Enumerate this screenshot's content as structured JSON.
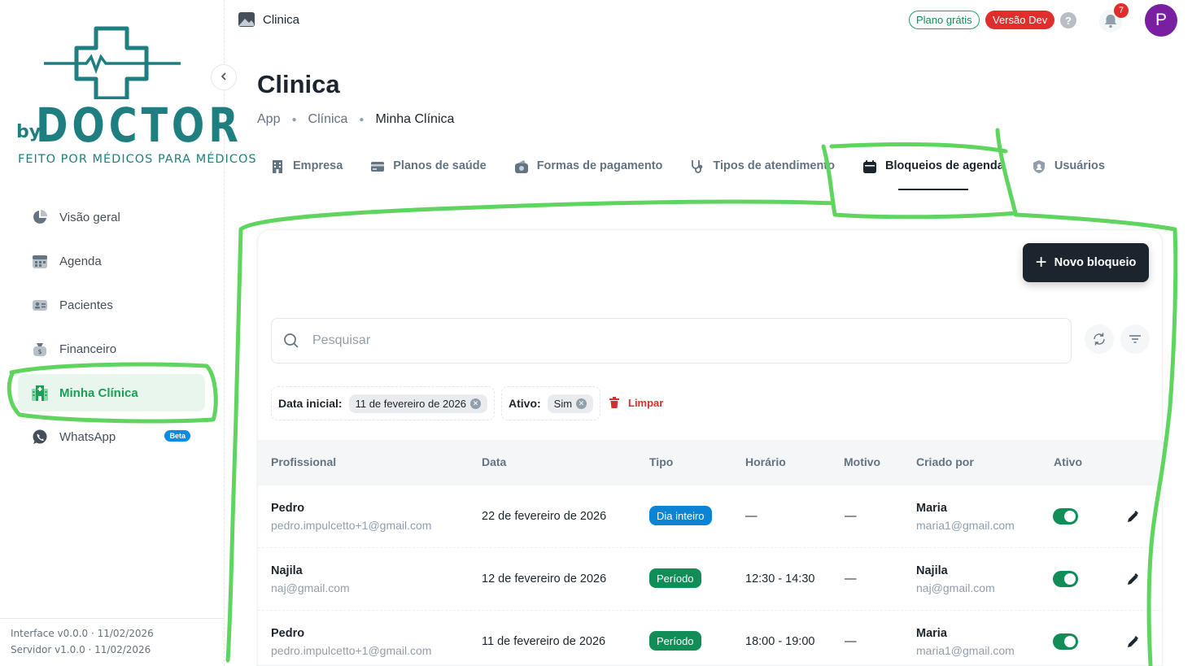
{
  "app": {
    "logo_by": "by",
    "logo_name": "DOCTOR",
    "logo_tagline": "FEITO POR MÉDICOS PARA MÉDICOS",
    "top_title": "Clinica",
    "plan_badge": "Plano grátis",
    "dev_badge": "Versão Dev",
    "help": "?",
    "notifications": "7",
    "avatar_letter": "P",
    "colors": {
      "brand": "#1f7f80",
      "accent": "#1a9f53",
      "dark": "#1c252e",
      "danger": "#e02d2d",
      "annotation": "#5fd45f"
    }
  },
  "sidebar": {
    "items": [
      {
        "label": "Visão geral",
        "icon": "pie-chart-icon"
      },
      {
        "label": "Agenda",
        "icon": "calendar-icon"
      },
      {
        "label": "Pacientes",
        "icon": "id-card-icon"
      },
      {
        "label": "Financeiro",
        "icon": "money-bag-icon"
      },
      {
        "label": "Minha Clínica",
        "icon": "hospital-icon",
        "active": true
      },
      {
        "label": "WhatsApp",
        "icon": "whatsapp-icon",
        "badge": "Beta"
      }
    ],
    "footer_interface": "Interface v0.0.0 · 11/02/2026",
    "footer_server": "Servidor v1.0.0 · 11/02/2026"
  },
  "page": {
    "title": "Clinica",
    "breadcrumb": [
      "App",
      "Clínica",
      "Minha Clínica"
    ]
  },
  "tabs": [
    {
      "label": "Empresa",
      "icon": "building-icon"
    },
    {
      "label": "Planos de saúde",
      "icon": "card-icon"
    },
    {
      "label": "Formas de pagamento",
      "icon": "wallet-icon"
    },
    {
      "label": "Tipos de atendimento",
      "icon": "stethoscope-icon"
    },
    {
      "label": "Bloqueios de agenda",
      "icon": "calendar-icon",
      "active": true
    },
    {
      "label": "Usuários",
      "icon": "shield-user-icon"
    }
  ],
  "toolbar": {
    "new_button": "Novo bloqueio",
    "search_placeholder": "Pesquisar"
  },
  "filters": {
    "start_label": "Data inicial:",
    "start_value": "11 de fevereiro de 2026",
    "active_label": "Ativo:",
    "active_value": "Sim",
    "clear_label": "Limpar"
  },
  "table": {
    "columns": [
      "Profissional",
      "Data",
      "Tipo",
      "Horário",
      "Motivo",
      "Criado por",
      "Ativo"
    ],
    "rows": [
      {
        "prof_name": "Pedro",
        "prof_email": "pedro.impulcetto+1@gmail.com",
        "date": "22 de fevereiro de 2026",
        "type": "Dia inteiro",
        "type_color": "#0b84d6",
        "time": "—",
        "reason": "—",
        "creator_name": "Maria",
        "creator_email": "maria1@gmail.com",
        "active": true
      },
      {
        "prof_name": "Najila",
        "prof_email": "naj@gmail.com",
        "date": "12 de fevereiro de 2026",
        "type": "Período",
        "type_color": "#118d57",
        "time": "12:30 - 14:30",
        "reason": "—",
        "creator_name": "Najila",
        "creator_email": "naj@gmail.com",
        "active": true
      },
      {
        "prof_name": "Pedro",
        "prof_email": "pedro.impulcetto+1@gmail.com",
        "date": "11 de fevereiro de 2026",
        "type": "Período",
        "type_color": "#118d57",
        "time": "18:00 - 19:00",
        "reason": "—",
        "creator_name": "Maria",
        "creator_email": "maria1@gmail.com",
        "active": true
      }
    ]
  }
}
